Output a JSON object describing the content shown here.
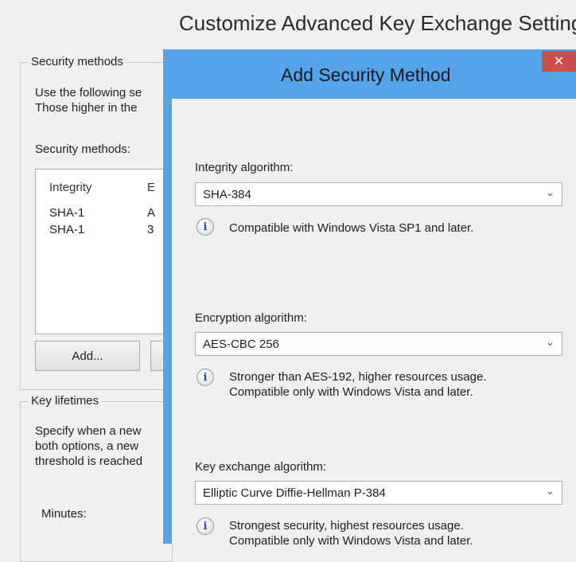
{
  "background_window": {
    "title": "Customize Advanced Key Exchange Settings",
    "security_group": {
      "legend": "Security methods",
      "description_line1": "Use the following se",
      "description_line2": "Those higher in the",
      "list_label": "Security methods:",
      "columns": [
        "Integrity",
        "E"
      ],
      "rows": [
        {
          "integrity": "SHA-1",
          "col2": "A"
        },
        {
          "integrity": "SHA-1",
          "col2": "3"
        }
      ],
      "add_button": "Add..."
    },
    "key_lifetimes_group": {
      "legend": "Key lifetimes",
      "description_line1": "Specify when a new",
      "description_line2": "both options, a new",
      "description_line3": "threshold is reached",
      "minutes_label": "Minutes:"
    }
  },
  "dialog": {
    "title": "Add Security Method",
    "close_glyph": "✕",
    "integrity": {
      "label": "Integrity algorithm:",
      "value": "SHA-384",
      "info_line1": "Compatible with Windows Vista SP1 and later."
    },
    "encryption": {
      "label": "Encryption algorithm:",
      "value": "AES-CBC 256",
      "info_line1": "Stronger than AES-192, higher resources usage.",
      "info_line2": "Compatible only with Windows Vista and later."
    },
    "key_exchange": {
      "label": "Key exchange algorithm:",
      "value": "Elliptic Curve Diffie-Hellman P-384",
      "info_line1": "Strongest security, highest resources usage.",
      "info_line2": "Compatible only with Windows Vista and later."
    },
    "info_icon_glyph": "i",
    "dropdown_glyph": "⌄"
  },
  "colors": {
    "dialog_frame": "#55a3e8",
    "close_button": "#c7504a",
    "window_background": "#f0f0f0"
  },
  "icons": [
    "close-icon",
    "info-icon",
    "chevron-down-icon"
  ]
}
